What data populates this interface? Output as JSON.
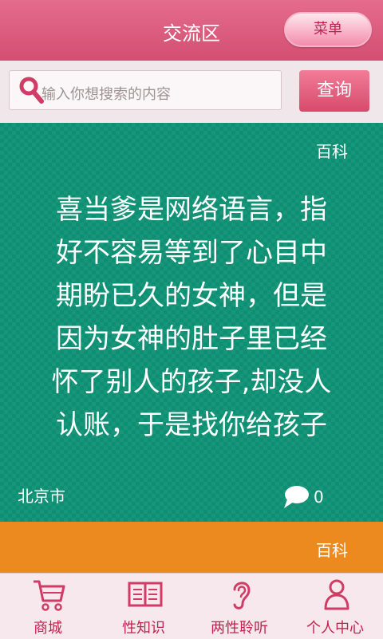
{
  "header": {
    "title": "交流区",
    "menu_label": "菜单"
  },
  "search": {
    "placeholder": "输入你想搜索的内容",
    "button_label": "查询",
    "icon": "search-icon"
  },
  "posts": [
    {
      "tag": "百科",
      "content": "喜当爹是网络语言，指好不容易等到了心目中期盼已久的女神，但是因为女神的肚子里已经怀了别人的孩子,却没人认账，于是找你给孩子",
      "location": "北京市",
      "comment_count": "0",
      "background": "#0d8f73"
    },
    {
      "tag": "百科",
      "background": "#ec8a1f"
    }
  ],
  "bottom_nav": [
    {
      "label": "商城",
      "icon": "shopping-cart-icon"
    },
    {
      "label": "性知识",
      "icon": "book-icon"
    },
    {
      "label": "两性聆听",
      "icon": "ear-icon"
    },
    {
      "label": "个人中心",
      "icon": "user-icon"
    }
  ],
  "colors": {
    "accent": "#d34f72",
    "nav_text": "#c2224f"
  }
}
